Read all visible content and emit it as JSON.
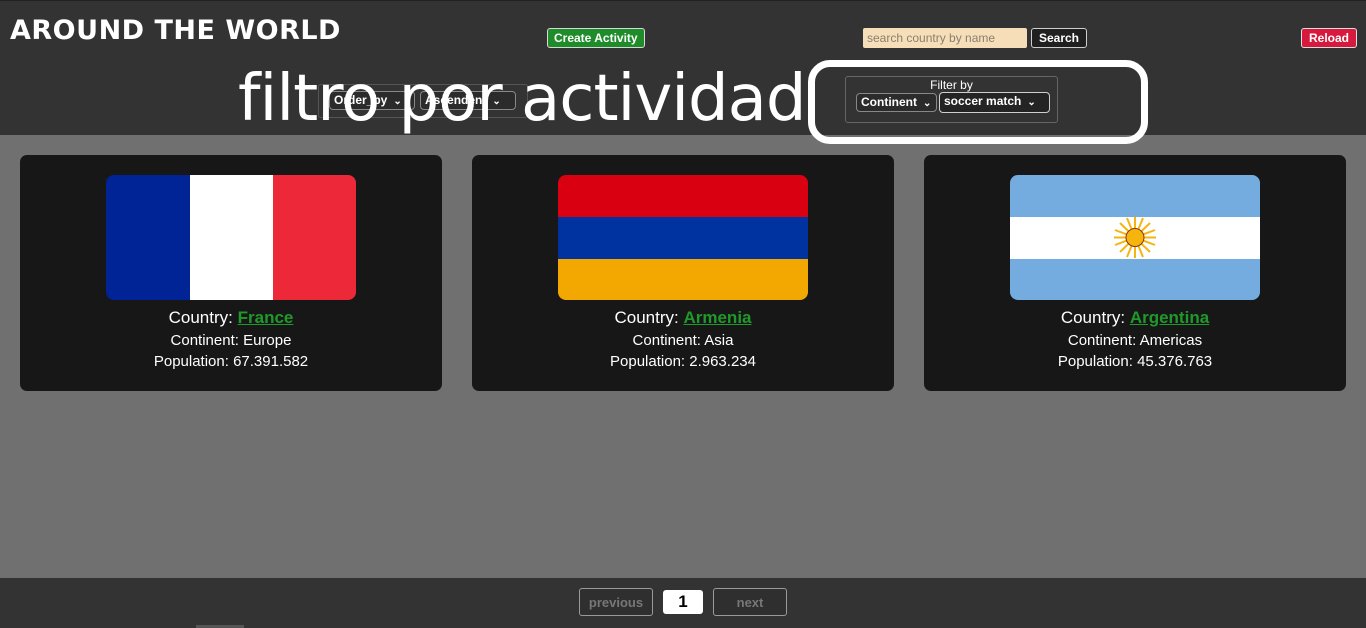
{
  "header": {
    "logo": "AROUND THE WORLD",
    "create_activity_label": "Create Activity",
    "search_placeholder": "search country by name",
    "search_label": "Search",
    "reload_label": "Reload"
  },
  "order": {
    "order_by_value": "Order_by",
    "direction_value": "Ascendent"
  },
  "filter": {
    "label": "Filter by",
    "continent_value": "Continent",
    "activity_value": "soccer match"
  },
  "annotation": {
    "text": "filtro por actividad"
  },
  "cards": [
    {
      "country_prefix": "Country: ",
      "country": "France",
      "continent_line": "Continent: Europe",
      "population_line": "Population: 67.391.582",
      "flag": "flag-france"
    },
    {
      "country_prefix": "Country: ",
      "country": "Armenia",
      "continent_line": "Continent: Asia",
      "population_line": "Population: 2.963.234",
      "flag": "flag-armenia"
    },
    {
      "country_prefix": "Country: ",
      "country": "Argentina",
      "continent_line": "Continent: Americas",
      "population_line": "Population: 45.376.763",
      "flag": "flag-argentina"
    }
  ],
  "pagination": {
    "previous_label": "previous",
    "current_page": "1",
    "next_label": "next"
  },
  "colors": {
    "header_bg": "#333333",
    "page_bg": "#707070",
    "card_bg": "#171717",
    "create_green": "#1f8c2a",
    "reload_red": "#d8193e",
    "link_green": "#1f9a2a"
  }
}
